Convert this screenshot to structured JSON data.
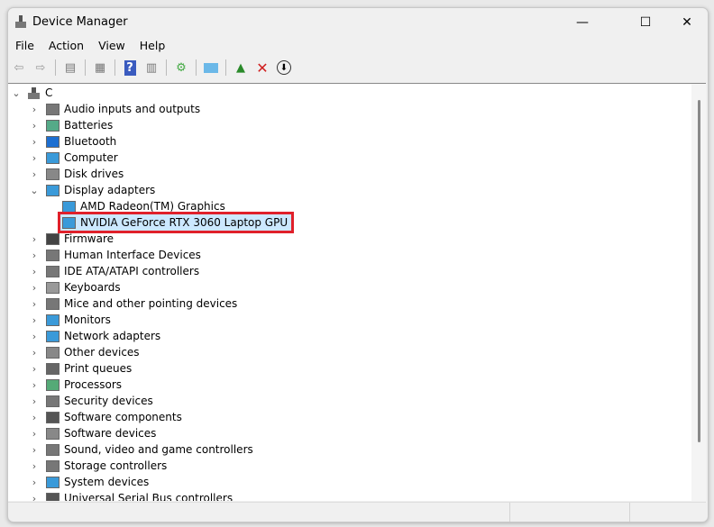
{
  "window": {
    "title": "Device Manager",
    "minimize": "—",
    "maximize": "☐",
    "close": "✕"
  },
  "menu": [
    "File",
    "Action",
    "View",
    "Help"
  ],
  "toolbar": [
    "back-icon",
    "forward-icon",
    "show-hide-console-tree-icon",
    "properties-icon",
    "help-icon",
    "show-action-pane-icon",
    "scan-hardware-icon",
    "monitor-icon",
    "update-driver-icon",
    "uninstall-icon",
    "disable-icon"
  ],
  "tree": {
    "root": "C",
    "items": [
      {
        "label": "Audio inputs and outputs",
        "icon": "speaker-icon",
        "color": "#777"
      },
      {
        "label": "Batteries",
        "icon": "battery-icon",
        "color": "#5a8"
      },
      {
        "label": "Bluetooth",
        "icon": "bluetooth-icon",
        "color": "#1d6fd1"
      },
      {
        "label": "Computer",
        "icon": "computer-icon",
        "color": "#3a9ad9"
      },
      {
        "label": "Disk drives",
        "icon": "disk-icon",
        "color": "#888"
      },
      {
        "label": "Display adapters",
        "icon": "display-adapter-icon",
        "color": "#3a9ad9",
        "expanded": true,
        "children": [
          {
            "label": "AMD Radeon(TM) Graphics"
          },
          {
            "label": "NVIDIA GeForce RTX 3060 Laptop GPU",
            "selected": true
          }
        ]
      },
      {
        "label": "Firmware",
        "icon": "chip-icon",
        "color": "#444"
      },
      {
        "label": "Human Interface Devices",
        "icon": "hid-icon",
        "color": "#777"
      },
      {
        "label": "IDE ATA/ATAPI controllers",
        "icon": "ide-icon",
        "color": "#777"
      },
      {
        "label": "Keyboards",
        "icon": "keyboard-icon",
        "color": "#999"
      },
      {
        "label": "Mice and other pointing devices",
        "icon": "mouse-icon",
        "color": "#777"
      },
      {
        "label": "Monitors",
        "icon": "monitor-icon",
        "color": "#3a9ad9"
      },
      {
        "label": "Network adapters",
        "icon": "network-icon",
        "color": "#3a9ad9"
      },
      {
        "label": "Other devices",
        "icon": "unknown-device-icon",
        "color": "#888"
      },
      {
        "label": "Print queues",
        "icon": "printer-icon",
        "color": "#666"
      },
      {
        "label": "Processors",
        "icon": "processor-icon",
        "color": "#5a7"
      },
      {
        "label": "Security devices",
        "icon": "security-icon",
        "color": "#777"
      },
      {
        "label": "Software components",
        "icon": "component-icon",
        "color": "#555"
      },
      {
        "label": "Software devices",
        "icon": "software-device-icon",
        "color": "#888"
      },
      {
        "label": "Sound, video and game controllers",
        "icon": "speaker-icon",
        "color": "#777"
      },
      {
        "label": "Storage controllers",
        "icon": "storage-icon",
        "color": "#777"
      },
      {
        "label": "System devices",
        "icon": "system-icon",
        "color": "#3a9ad9"
      },
      {
        "label": "Universal Serial Bus controllers",
        "icon": "usb-icon",
        "color": "#555"
      }
    ]
  },
  "highlight_color": "#e0202a"
}
